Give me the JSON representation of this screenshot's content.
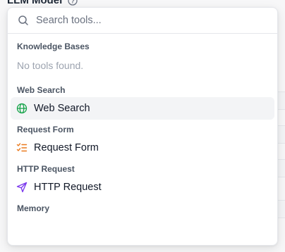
{
  "background": {
    "field_label": "LLM Model"
  },
  "search": {
    "placeholder": "Search tools..."
  },
  "groups": {
    "knowledge_bases": {
      "heading": "Knowledge Bases",
      "empty_text": "No tools found."
    },
    "web_search": {
      "heading": "Web Search",
      "item_label": "Web Search",
      "icon": "globe-icon",
      "icon_color": "#16a34a"
    },
    "request_form": {
      "heading": "Request Form",
      "item_label": "Request Form",
      "icon": "list-checks-icon",
      "icon_color": "#ea7a1f"
    },
    "http_request": {
      "heading": "HTTP Request",
      "item_label": "HTTP Request",
      "icon": "send-icon",
      "icon_color": "#7c3aed"
    },
    "memory": {
      "heading": "Memory"
    }
  },
  "colors": {
    "active_item_bg": "#f3f4f6",
    "heading_text": "#4b5563",
    "muted_text": "#9ca3af"
  }
}
